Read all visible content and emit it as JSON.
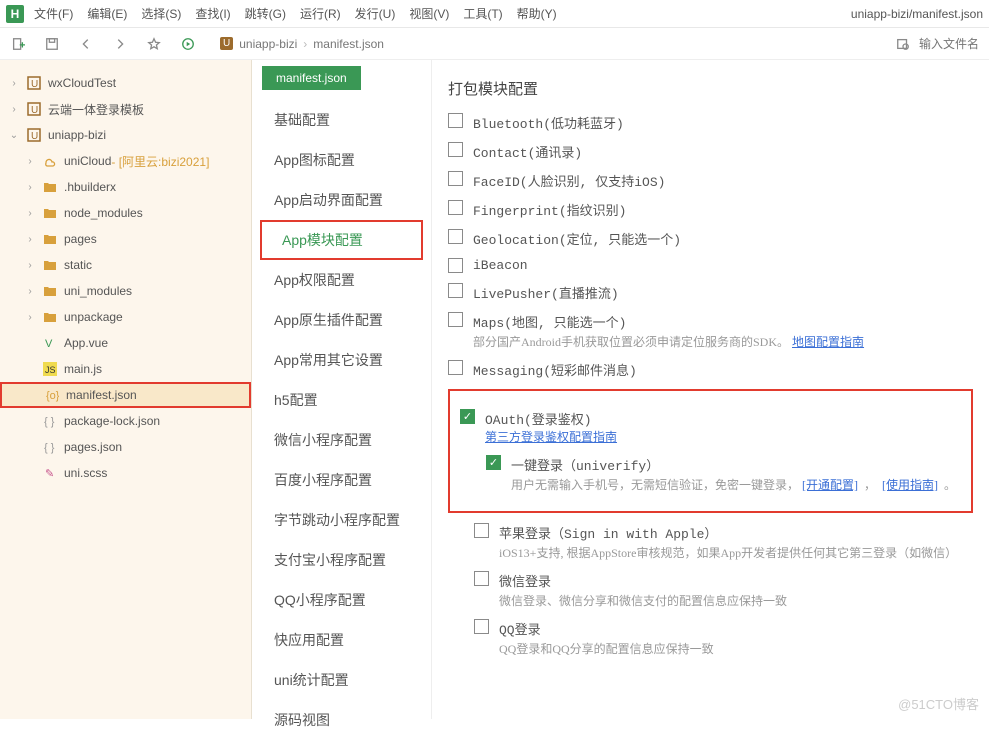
{
  "menubar": {
    "items": [
      "文件(F)",
      "编辑(E)",
      "选择(S)",
      "查找(I)",
      "跳转(G)",
      "运行(R)",
      "发行(U)",
      "视图(V)",
      "工具(T)",
      "帮助(Y)"
    ],
    "titlepath": "uniapp-bizi/manifest.json"
  },
  "breadcrumb": {
    "proj": "uniapp-bizi",
    "file": "manifest.json"
  },
  "search": {
    "placeholder": "输入文件名"
  },
  "sidebar": {
    "items": [
      {
        "label": "wxCloudTest",
        "type": "proj",
        "state": "collapsed",
        "ind": 0
      },
      {
        "label": "云端一体登录模板",
        "type": "proj",
        "state": "collapsed",
        "ind": 0
      },
      {
        "label": "uniapp-bizi",
        "type": "proj",
        "state": "expanded",
        "ind": 0
      },
      {
        "label": "uniCloud",
        "suffix": " - [阿里云:bizi2021]",
        "type": "cloud",
        "state": "collapsed",
        "ind": 1
      },
      {
        "label": ".hbuilderx",
        "type": "folder",
        "state": "collapsed",
        "ind": 1
      },
      {
        "label": "node_modules",
        "type": "folder",
        "state": "collapsed",
        "ind": 1
      },
      {
        "label": "pages",
        "type": "folder",
        "state": "collapsed",
        "ind": 1
      },
      {
        "label": "static",
        "type": "folder",
        "state": "collapsed",
        "ind": 1
      },
      {
        "label": "uni_modules",
        "type": "folder",
        "state": "collapsed",
        "ind": 1
      },
      {
        "label": "unpackage",
        "type": "folder",
        "state": "collapsed",
        "ind": 1
      },
      {
        "label": "App.vue",
        "type": "vue",
        "state": "none",
        "ind": 1
      },
      {
        "label": "main.js",
        "type": "js",
        "state": "none",
        "ind": 1
      },
      {
        "label": "manifest.json",
        "type": "json",
        "state": "none",
        "ind": 1,
        "selected": true
      },
      {
        "label": "package-lock.json",
        "type": "json2",
        "state": "none",
        "ind": 1
      },
      {
        "label": "pages.json",
        "type": "json2",
        "state": "none",
        "ind": 1
      },
      {
        "label": "uni.scss",
        "type": "scss",
        "state": "none",
        "ind": 1
      }
    ]
  },
  "confnav": {
    "tab": "manifest.json",
    "items": [
      "基础配置",
      "App图标配置",
      "App启动界面配置",
      "App模块配置",
      "App权限配置",
      "App原生插件配置",
      "App常用其它设置",
      "h5配置",
      "微信小程序配置",
      "百度小程序配置",
      "字节跳动小程序配置",
      "支付宝小程序配置",
      "QQ小程序配置",
      "快应用配置",
      "uni统计配置",
      "源码视图"
    ],
    "active": 3
  },
  "content": {
    "title": "打包模块配置",
    "modules": [
      {
        "label": "Bluetooth(低功耗蓝牙)",
        "checked": false
      },
      {
        "label": "Contact(通讯录)",
        "checked": false
      },
      {
        "label": "FaceID(人脸识别, 仅支持iOS)",
        "checked": false
      },
      {
        "label": "Fingerprint(指纹识别)",
        "checked": false
      },
      {
        "label": "Geolocation(定位, 只能选一个)",
        "checked": false
      },
      {
        "label": "iBeacon",
        "checked": false
      },
      {
        "label": "LivePusher(直播推流)",
        "checked": false
      },
      {
        "label": "Maps(地图, 只能选一个)",
        "checked": false,
        "sub": "部分国产Android手机获取位置必须申请定位服务商的SDK。",
        "sublink": "地图配置指南"
      },
      {
        "label": "Messaging(短彩邮件消息)",
        "checked": false
      }
    ],
    "oauth": {
      "label": "OAuth(登录鉴权)",
      "link": "第三方登录鉴权配置指南",
      "univerify": {
        "label": "一键登录（univerify）",
        "sub": "用户无需输入手机号，无需短信验证，免密一键登录，",
        "link1": "[开通配置]",
        "link2": "[使用指南]"
      }
    },
    "apple": {
      "label": "苹果登录（Sign in with Apple）",
      "sub": "iOS13+支持, 根据AppStore审核规范，如果App开发者提供任何其它第三登录（如微信）"
    },
    "wechat": {
      "label": "微信登录",
      "sub": "微信登录、微信分享和微信支付的配置信息应保持一致"
    },
    "qq": {
      "label": "QQ登录",
      "sub": "QQ登录和QQ分享的配置信息应保持一致"
    }
  },
  "watermark": "@51CTO博客"
}
